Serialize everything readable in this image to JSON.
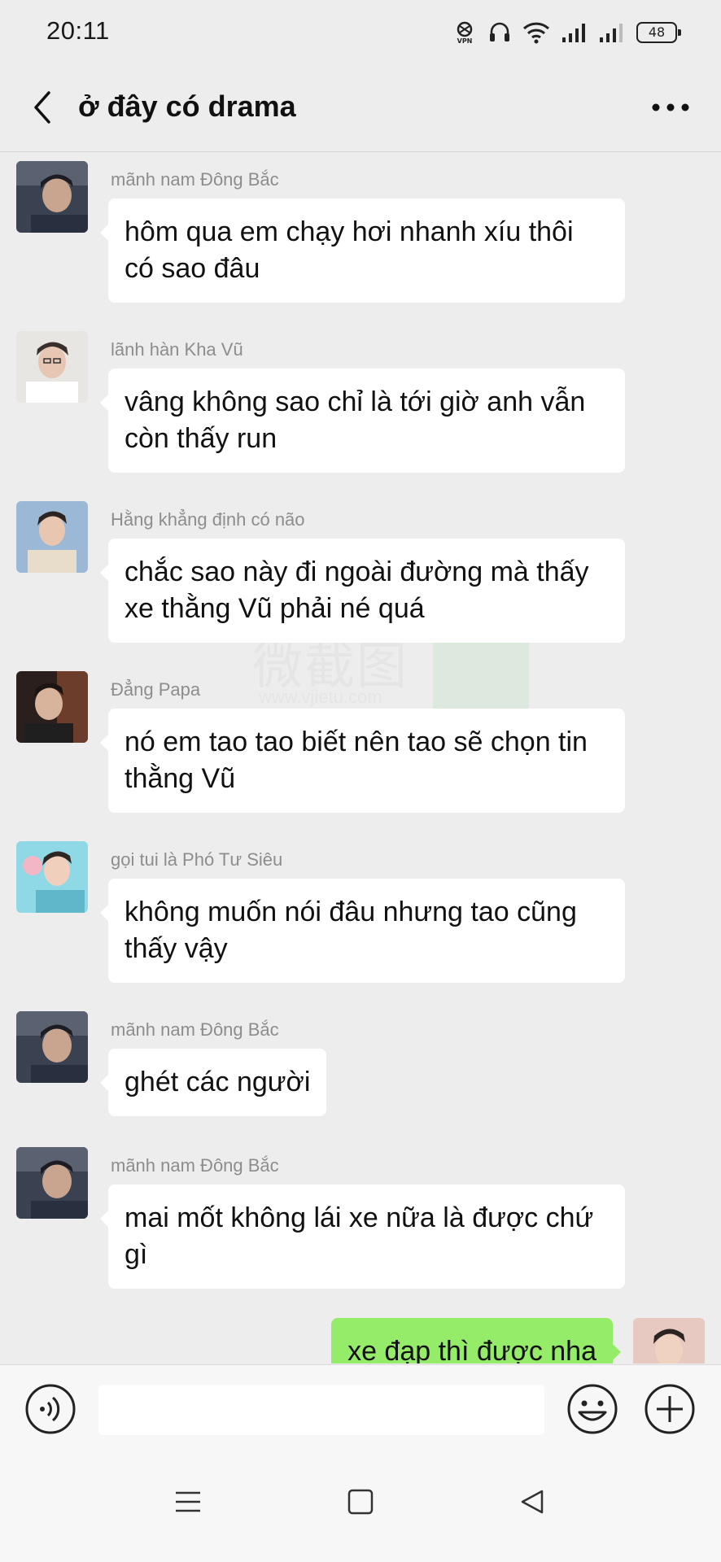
{
  "status_bar": {
    "time": "20:11",
    "battery": "48",
    "icons": [
      "vpn-icon",
      "headset-icon",
      "wifi-icon",
      "signal-icon",
      "signal-icon"
    ]
  },
  "header": {
    "title": "ở đây có drama",
    "back_icon": "chevron-left-icon",
    "more_icon": "more-horizontal-icon"
  },
  "messages": [
    {
      "sender": "mãnh nam Đông Bắc",
      "text": "hôm qua em chạy hơi nhanh xíu thôi có sao đâu"
    },
    {
      "sender": "lãnh hàn Kha Vũ",
      "text": "vâng không sao chỉ là tới giờ anh vẫn còn thấy run"
    },
    {
      "sender": "Hằng khẳng định có não",
      "text": "chắc sao này đi ngoài đường mà thấy xe thằng Vũ phải né quá"
    },
    {
      "sender": "Đẳng Papa",
      "text": "nó em tao tao biết nên tao sẽ chọn tin thằng Vũ"
    },
    {
      "sender": "gọi tui là Phó Tư Siêu",
      "text": "không muốn nói đâu nhưng tao cũng thấy vậy"
    },
    {
      "sender": "mãnh nam Đông Bắc",
      "text": "ghét các người"
    },
    {
      "sender": "mãnh nam Đông Bắc",
      "text": "mai mốt không lái xe nữa là được chứ gì"
    },
    {
      "sender": "",
      "text": "xe đạp thì được nha",
      "mine": true
    }
  ],
  "watermark": {
    "text": "微截图",
    "url": "www.vjietu.com"
  },
  "input_bar": {
    "value": "",
    "placeholder": "",
    "icons": [
      "voice-icon",
      "emoji-icon",
      "plus-icon"
    ]
  },
  "nav_bar": {
    "icons": [
      "menu-icon",
      "home-icon",
      "back-triangle-icon"
    ]
  },
  "colors": {
    "background": "#ededed",
    "bubble_other": "#ffffff",
    "bubble_self": "#95ec69",
    "sender_name": "#8d8d8d"
  }
}
